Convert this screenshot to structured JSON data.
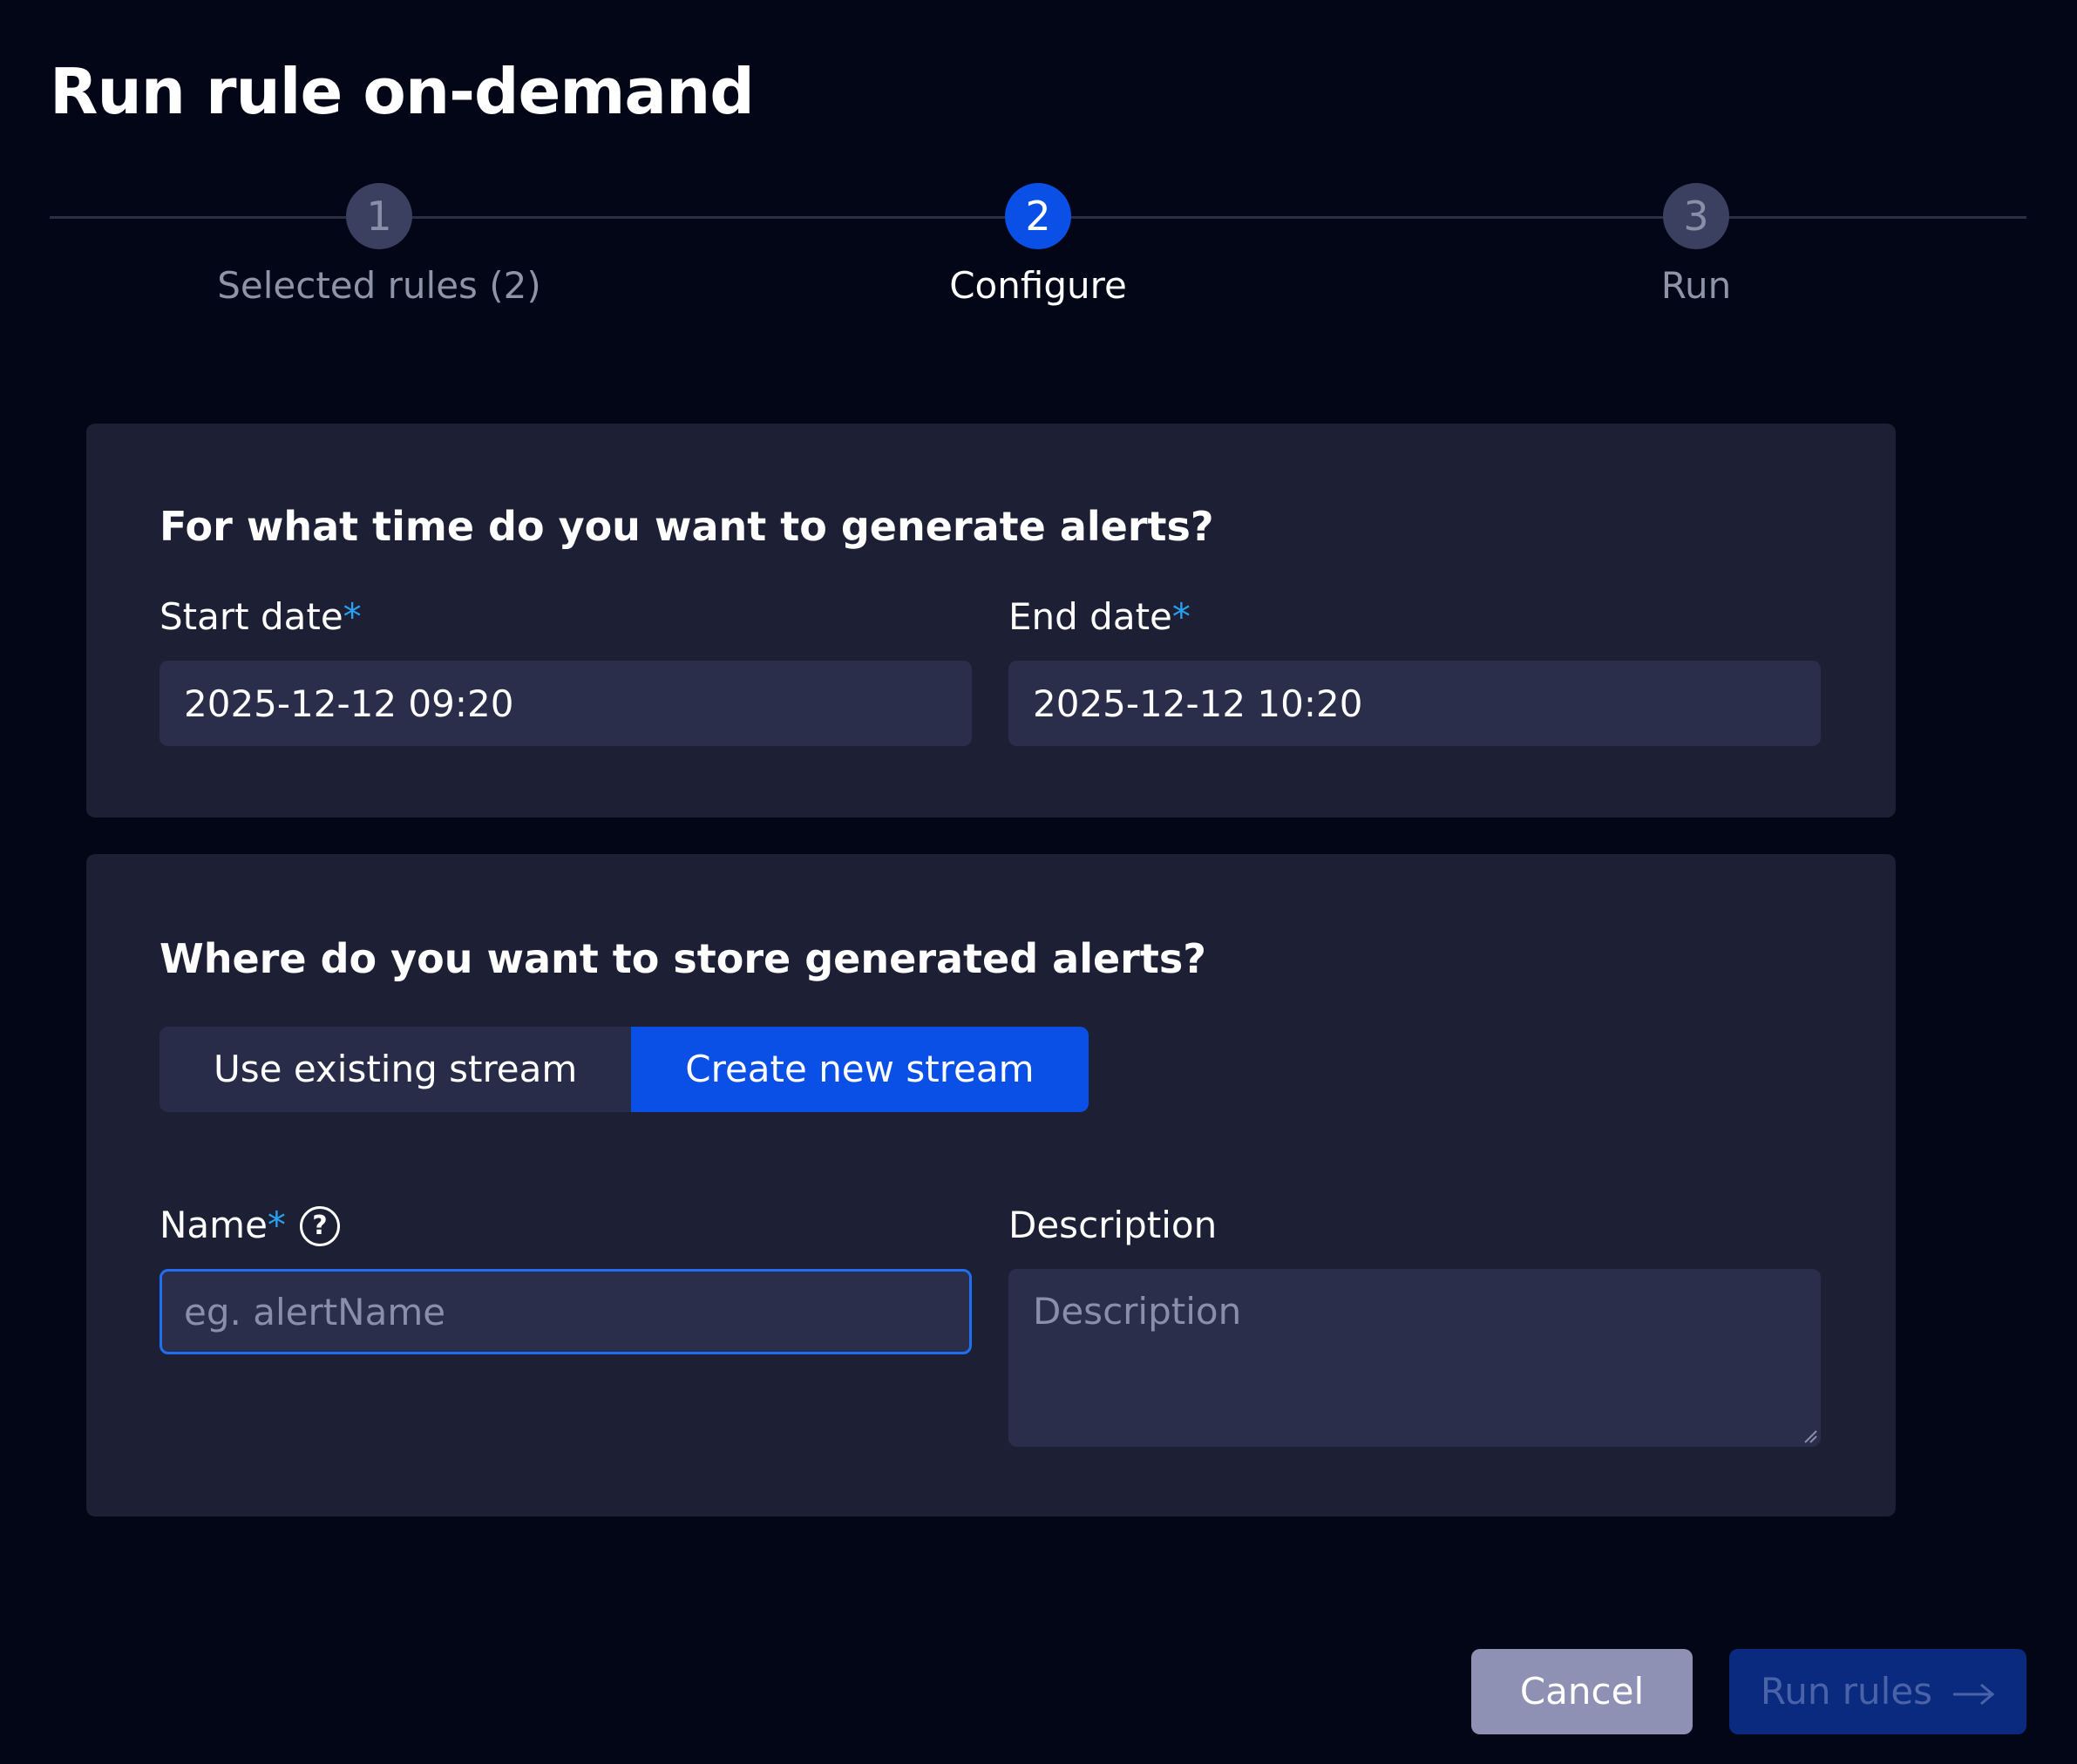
{
  "dialog": {
    "title": "Run rule on-demand"
  },
  "stepper": {
    "steps": [
      {
        "number": "1",
        "label": "Selected rules (2)",
        "state": "complete"
      },
      {
        "number": "2",
        "label": "Configure",
        "state": "active"
      },
      {
        "number": "3",
        "label": "Run",
        "state": "pending"
      }
    ]
  },
  "time_section": {
    "heading": "For what time do you want to generate alerts?",
    "start_label": "Start date",
    "end_label": "End date",
    "required_mark": "*",
    "start_value": "2025-12-12 09:20",
    "end_value": "2025-12-12 10:20"
  },
  "store_section": {
    "heading": "Where do you want to store generated alerts?",
    "toggle_existing": "Use existing stream",
    "toggle_new": "Create new stream",
    "selected_option": "Create new stream",
    "name_label": "Name",
    "name_placeholder": "eg. alertName",
    "help_glyph": "?",
    "description_label": "Description",
    "description_placeholder": "Description"
  },
  "footer": {
    "cancel_label": "Cancel",
    "run_label": "Run rules"
  },
  "colors": {
    "background": "#020617",
    "card": "#1d2035",
    "accent": "#0a4fe6",
    "required": "#29a0f0"
  }
}
